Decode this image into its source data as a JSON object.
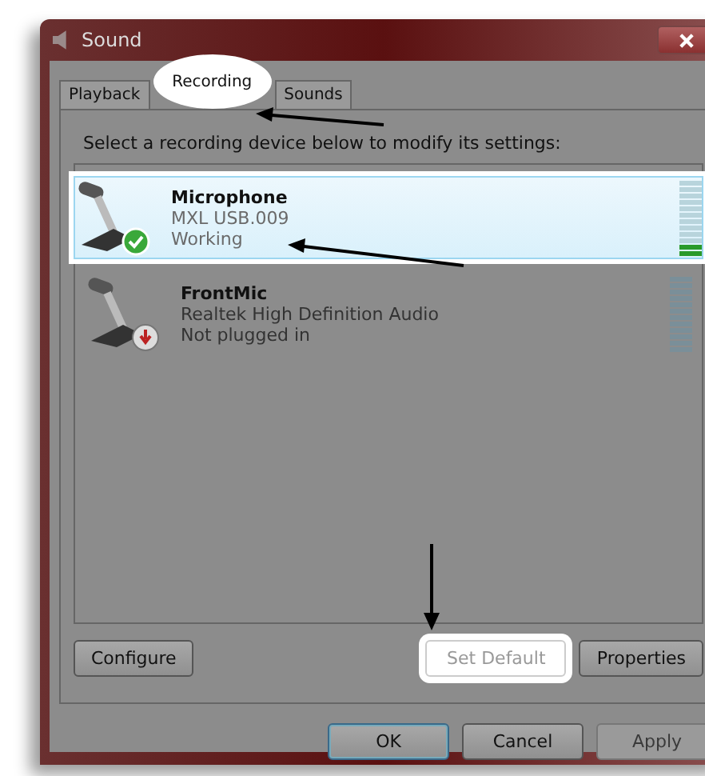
{
  "window": {
    "title": "Sound"
  },
  "tabs": [
    {
      "label": "Playback",
      "selected": false
    },
    {
      "label": "Recording",
      "selected": true
    },
    {
      "label": "Sounds",
      "selected": false
    }
  ],
  "instruction": "Select a recording device below to modify its settings:",
  "devices": [
    {
      "name": "Microphone",
      "description": "MXL USB.009",
      "status": "Working",
      "kind": "default",
      "selected": true,
      "level": 0.17
    },
    {
      "name": "FrontMic",
      "description": "Realtek High Definition Audio",
      "status": "Not plugged in",
      "kind": "unplugged",
      "selected": false,
      "level": 0
    }
  ],
  "device_buttons": [
    {
      "label": "Configure",
      "disabled": false,
      "highlighted": false
    },
    {
      "label": "Set Default",
      "disabled": true,
      "highlighted": true
    },
    {
      "label": "Properties",
      "disabled": false,
      "highlighted": false
    }
  ],
  "dialog_buttons": [
    {
      "label": "OK",
      "disabled": false,
      "default": true
    },
    {
      "label": "Cancel",
      "disabled": false,
      "default": false
    },
    {
      "label": "Apply",
      "disabled": true,
      "default": false
    }
  ]
}
